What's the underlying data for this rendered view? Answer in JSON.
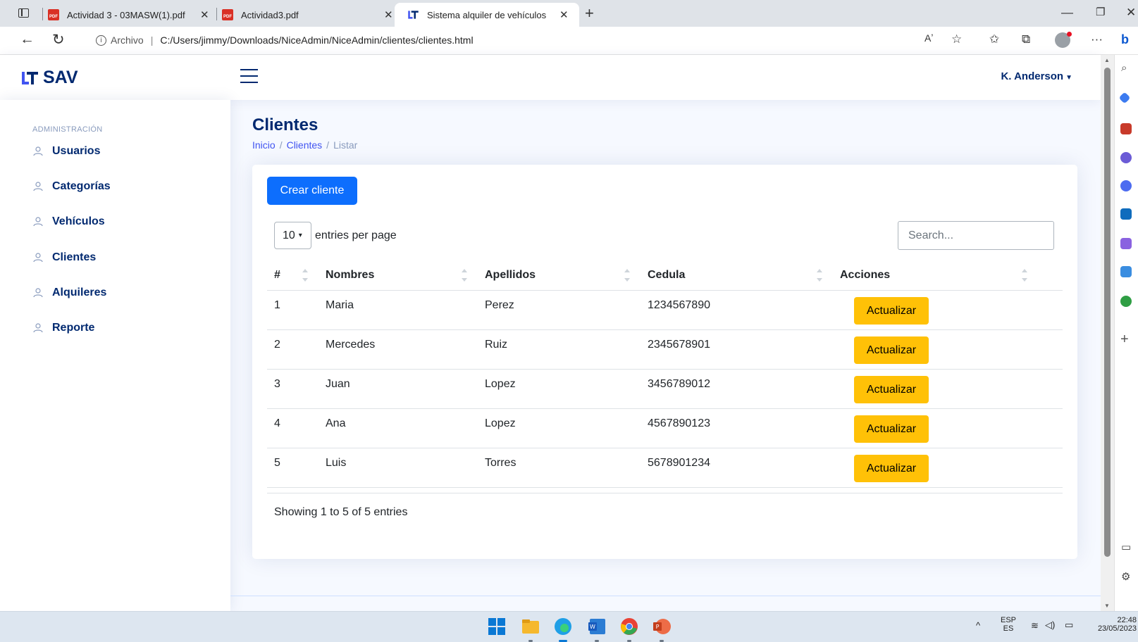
{
  "browser": {
    "tabs": [
      {
        "title": "Actividad 3 - 03MASW(1).pdf",
        "icon": "pdf-icon"
      },
      {
        "title": "Actividad3.pdf",
        "icon": "pdf-icon"
      },
      {
        "title": "Sistema alquiler de vehículos",
        "icon": "site-logo-icon",
        "active": true
      }
    ],
    "address": {
      "label": "Archivo",
      "url": "C:/Users/jimmy/Downloads/NiceAdmin/NiceAdmin/clientes/clientes.html"
    }
  },
  "app": {
    "brand": "SAV",
    "user": "K. Anderson",
    "sidebar": {
      "heading": "ADMINISTRACIÓN",
      "items": [
        {
          "label": "Usuarios"
        },
        {
          "label": "Categorías"
        },
        {
          "label": "Vehículos"
        },
        {
          "label": "Clientes"
        },
        {
          "label": "Alquileres"
        },
        {
          "label": "Reporte"
        }
      ]
    },
    "page": {
      "title": "Clientes",
      "breadcrumb": [
        "Inicio",
        "Clientes",
        "Listar"
      ]
    },
    "table": {
      "create_label": "Crear cliente",
      "per_page_value": "10",
      "per_page_label": "entries per page",
      "search_placeholder": "Search...",
      "columns": [
        "#",
        "Nombres",
        "Apellidos",
        "Cedula",
        "Acciones"
      ],
      "rows": [
        {
          "id": "1",
          "nombres": "Maria",
          "apellidos": "Perez",
          "cedula": "1234567890",
          "action": "Actualizar"
        },
        {
          "id": "2",
          "nombres": "Mercedes",
          "apellidos": "Ruiz",
          "cedula": "2345678901",
          "action": "Actualizar"
        },
        {
          "id": "3",
          "nombres": "Juan",
          "apellidos": "Lopez",
          "cedula": "3456789012",
          "action": "Actualizar"
        },
        {
          "id": "4",
          "nombres": "Ana",
          "apellidos": "Lopez",
          "cedula": "4567890123",
          "action": "Actualizar"
        },
        {
          "id": "5",
          "nombres": "Luis",
          "apellidos": "Torres",
          "cedula": "5678901234",
          "action": "Actualizar"
        }
      ],
      "footer": "Showing 1 to 5 of 5 entries"
    }
  },
  "taskbar": {
    "lang_top": "ESP",
    "lang_bottom": "ES",
    "time": "22:48",
    "date": "23/05/2023"
  },
  "colors": {
    "primary": "#0d6efd",
    "warning": "#ffc107",
    "brand_navy": "#012970",
    "link": "#4154f1"
  }
}
